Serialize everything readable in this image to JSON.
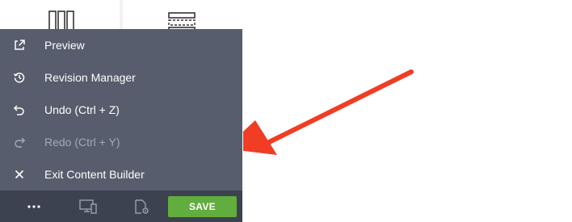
{
  "menu": {
    "items": [
      {
        "label": "Preview",
        "icon": "external-link-icon",
        "enabled": true
      },
      {
        "label": "Revision Manager",
        "icon": "history-icon",
        "enabled": true
      },
      {
        "label": "Undo (Ctrl + Z)",
        "icon": "undo-icon",
        "enabled": true
      },
      {
        "label": "Redo (Ctrl + Y)",
        "icon": "redo-icon",
        "enabled": false
      },
      {
        "label": "Exit Content Builder",
        "icon": "close-icon",
        "enabled": true
      }
    ]
  },
  "toolbar": {
    "more_icon": "more-dots-icon",
    "responsive_icon": "responsive-devices-icon",
    "settings_icon": "page-settings-icon",
    "save_label": "SAVE"
  },
  "colors": {
    "menu_bg": "#575d6c",
    "toolbar_bg": "#3c4250",
    "save_green": "#61ad3d",
    "arrow_red": "#f03d24",
    "disabled_text": "#a3a8b4"
  }
}
